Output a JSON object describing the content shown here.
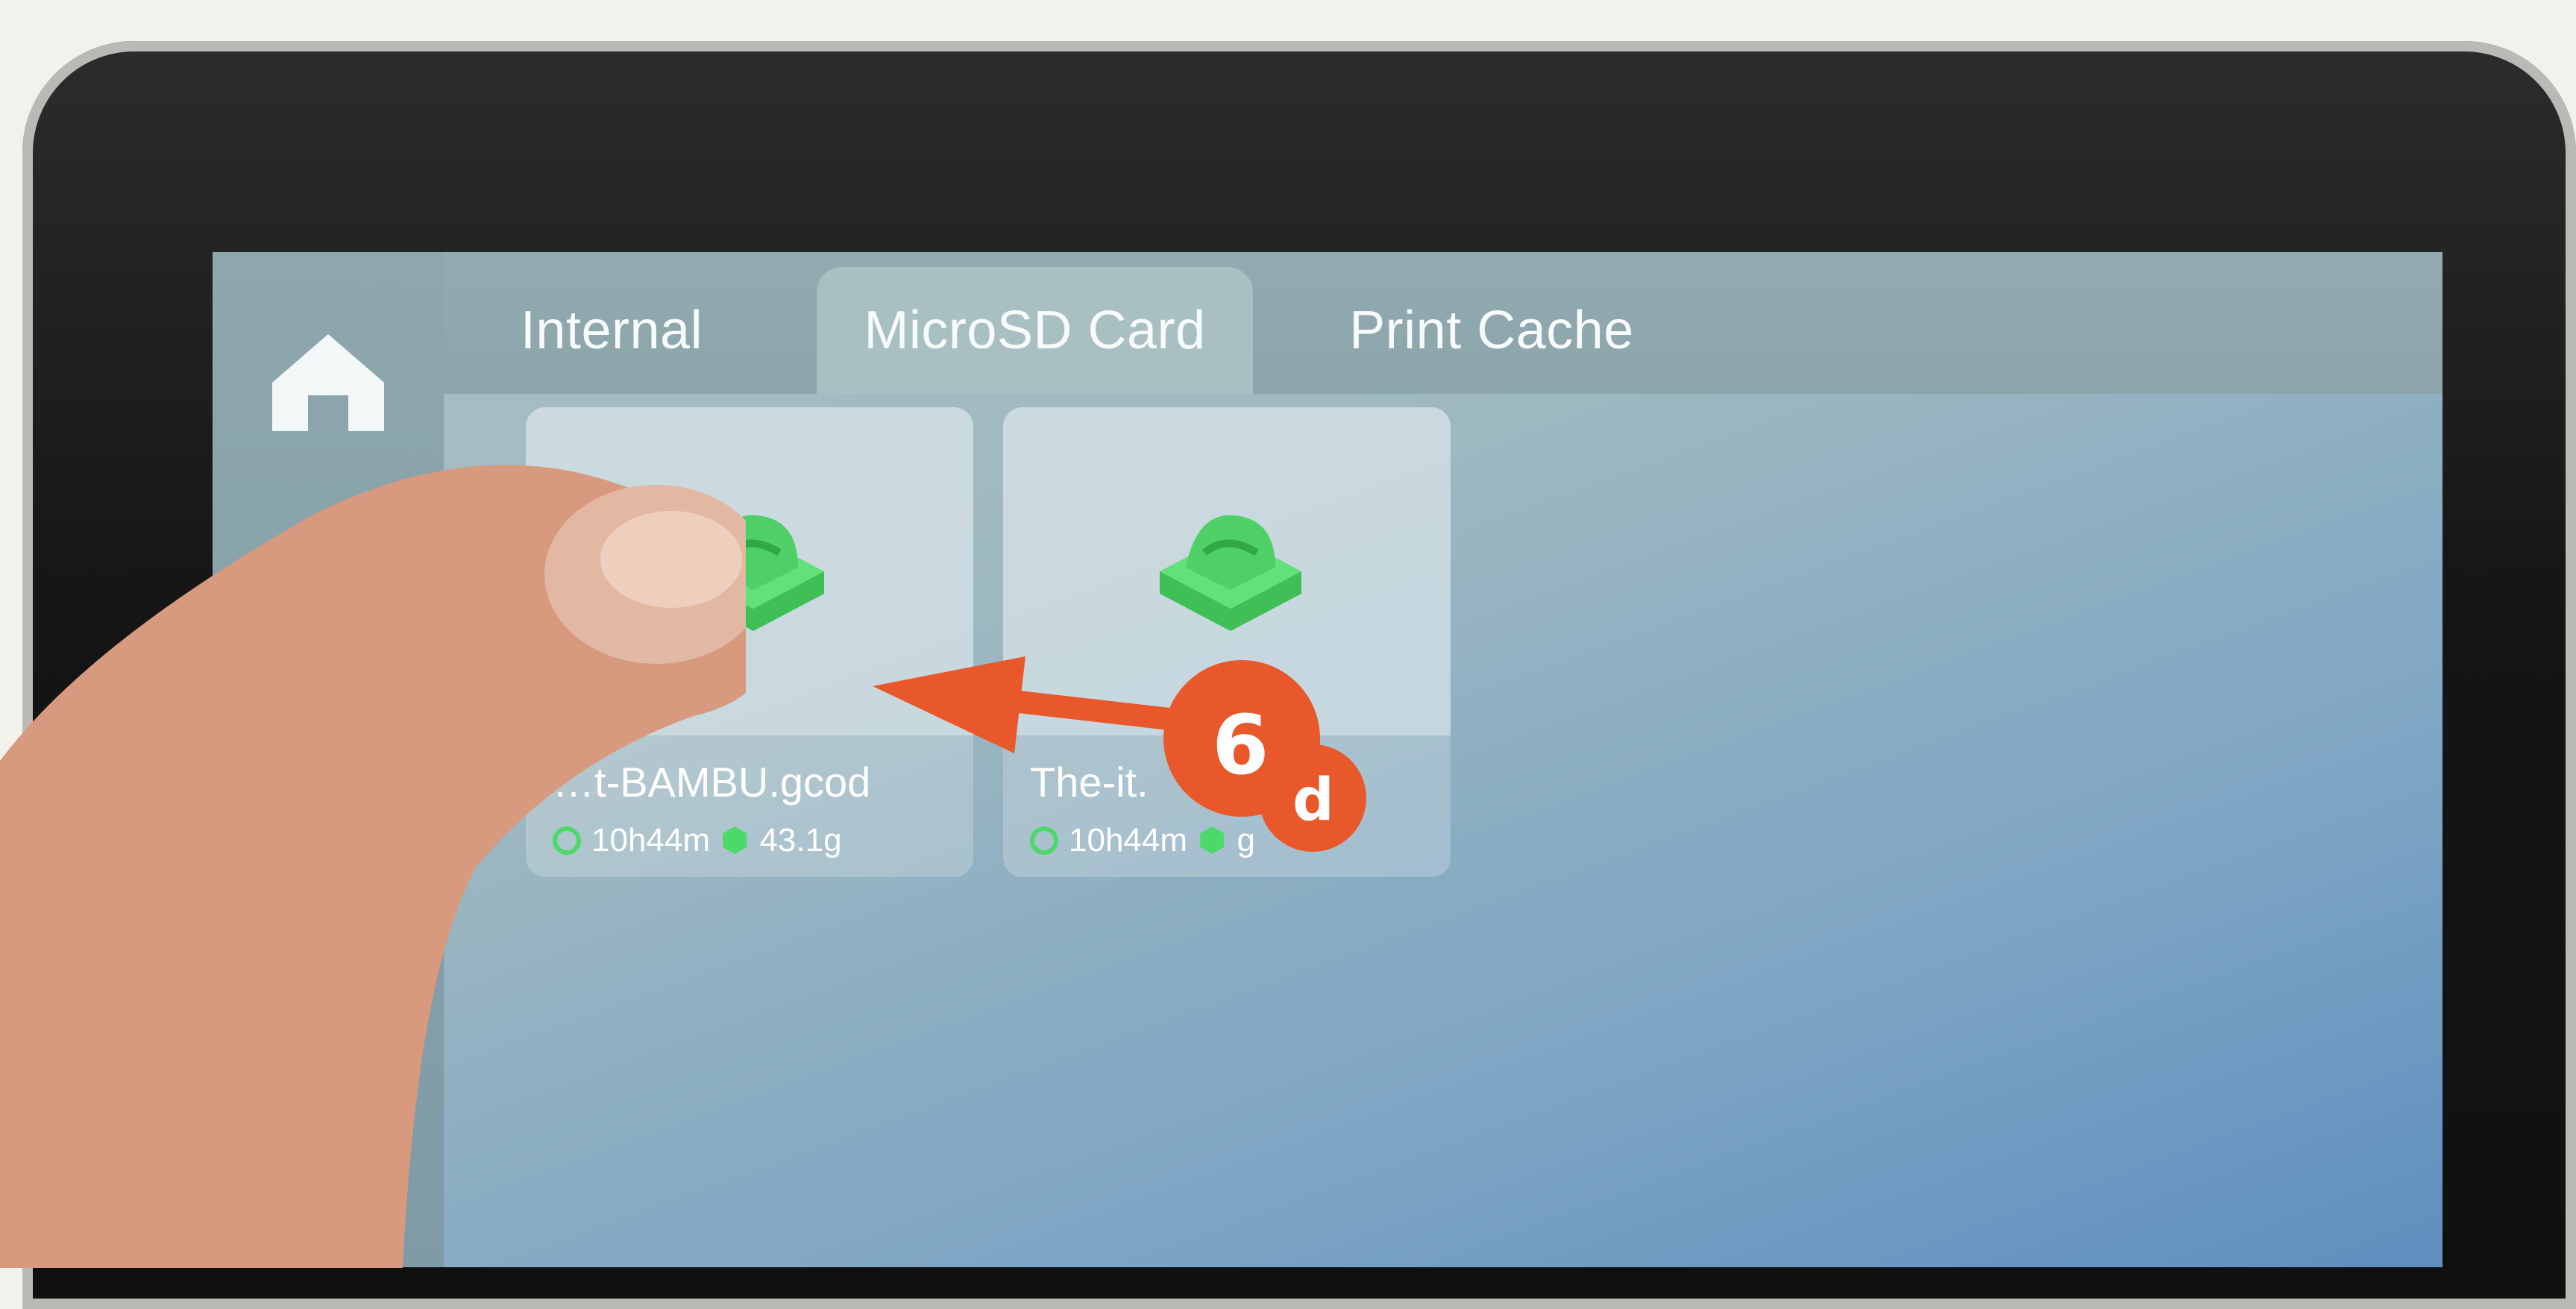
{
  "tabs": [
    {
      "label": "Internal"
    },
    {
      "label": "MicroSD Card"
    },
    {
      "label": "Print Cache"
    }
  ],
  "files": [
    {
      "name": "…t-BAMBU.gcod",
      "time": "10h44m",
      "weight": "43.1g"
    },
    {
      "name": "The-it.",
      "time": "10h44m",
      "weight": "g"
    }
  ],
  "annotation": {
    "step": "6",
    "sub": "d",
    "color": "#e8582a"
  },
  "colors": {
    "filament": "#4cd96a",
    "screen": "#a9c0c3"
  },
  "icons": {
    "home": "home-icon",
    "settings": "settings-hex-icon"
  }
}
